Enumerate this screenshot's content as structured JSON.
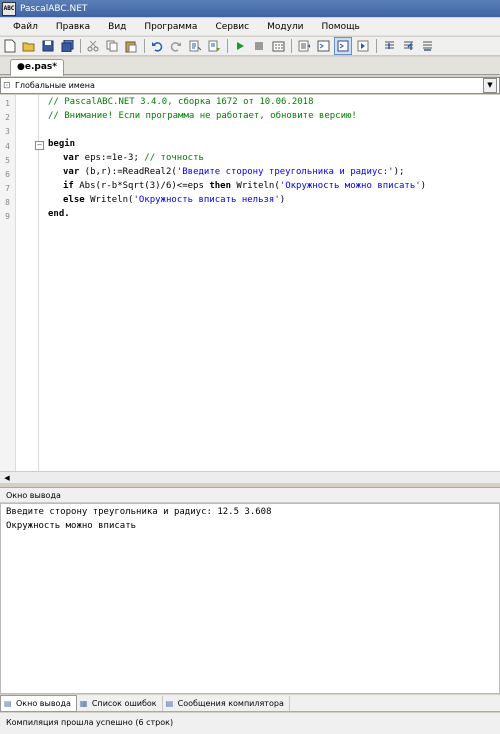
{
  "window": {
    "title": "PascalABC.NET",
    "icon_text": "ABC"
  },
  "menu": [
    "Файл",
    "Правка",
    "Вид",
    "Программа",
    "Сервис",
    "Модули",
    "Помощь"
  ],
  "toolbar": {
    "icons": [
      "new-file-icon",
      "open-icon",
      "save-icon",
      "save-all-icon",
      "cut-icon",
      "copy-icon",
      "paste-icon",
      "undo-icon",
      "redo-icon",
      "find-icon",
      "replace-icon",
      "run-icon",
      "stop-icon",
      "compile-icon",
      "debug-icon",
      "output-window-icon",
      "step-icon",
      "step-into-icon",
      "step-out-icon",
      "step-over-icon"
    ]
  },
  "editor": {
    "tab_label": "●e.pas*",
    "scope_label": "Глобальные имена",
    "line_numbers": [
      "1",
      "2",
      "3",
      "4",
      "5",
      "6",
      "7",
      "8",
      "9"
    ],
    "lines": {
      "l1": "// PascalABC.NET 3.4.0, сборка 1672 от 10.06.2018",
      "l2": "// Внимание! Если программа не работает, обновите версию!",
      "l4_kw": "begin",
      "l5_kw": "var",
      "l5_rest": " eps:=1e-3; ",
      "l5_cm": "// точность",
      "l6_kw": "var",
      "l6_a": " (b,r):=ReadReal2(",
      "l6_st": "'Введите сторону треугольника и радиус:'",
      "l6_b": ");",
      "l7_kw1": "if",
      "l7_a": " Abs(r-b*Sqrt(3)/6)<=eps ",
      "l7_kw2": "then",
      "l7_b": " Writeln(",
      "l7_st": "'Окружность можно вписать'",
      "l7_c": ")",
      "l8_kw": "else",
      "l8_a": " Writeln(",
      "l8_st": "'Окружность вписать нельзя'",
      "l8_b": ")",
      "l9_kw": "end."
    }
  },
  "output": {
    "header": "Окно вывода",
    "lines": [
      "Введите сторону треугольника и радиус: 12.5 3.608",
      "Окружность можно вписать"
    ]
  },
  "bottom_tabs": [
    {
      "label": "Окно вывода",
      "icon": "output-icon"
    },
    {
      "label": "Список ошибок",
      "icon": "error-list-icon"
    },
    {
      "label": "Сообщения компилятора",
      "icon": "compiler-messages-icon"
    }
  ],
  "status": "Компиляция прошла успешно (6 строк)"
}
